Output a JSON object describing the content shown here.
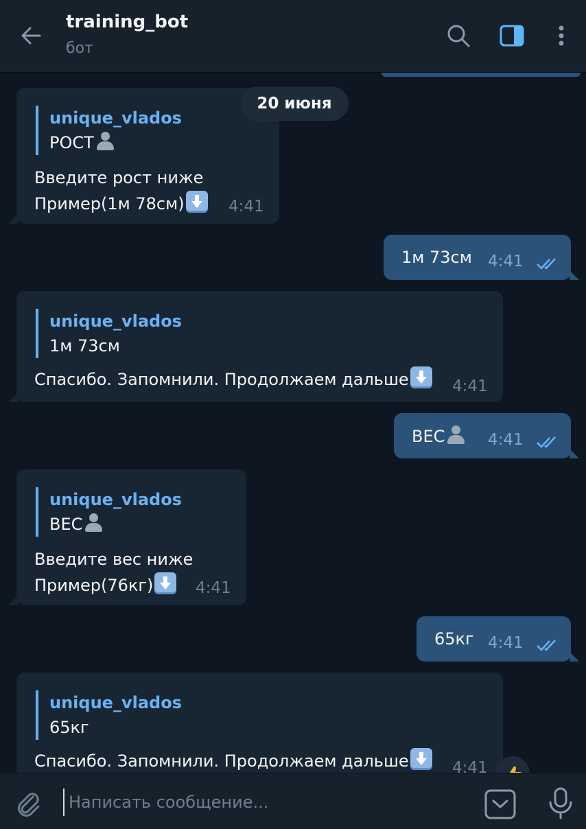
{
  "header": {
    "title": "training_bot",
    "subtitle": "бот",
    "icons": [
      "back-arrow-icon",
      "search-icon",
      "side-panel-icon",
      "more-vertical-icon"
    ]
  },
  "date_separator": "20 июня",
  "messages": [
    {
      "direction": "incoming",
      "quote_author": "unique_vlados",
      "quote_text": "РОСТ",
      "quote_emoji": "person-silhouette",
      "lines": [
        "Введите рост ниже",
        "Пример(1м 78см)"
      ],
      "trailing_emoji": "down-arrow",
      "time": "4:41"
    },
    {
      "direction": "outgoing",
      "text": "1м 73см",
      "time": "4:41",
      "status": "read"
    },
    {
      "direction": "incoming",
      "quote_author": "unique_vlados",
      "quote_text": "1м 73см",
      "lines": [
        "Спасибо. Запомнили. Продолжаем дальше"
      ],
      "trailing_emoji": "down-arrow",
      "time": "4:41"
    },
    {
      "direction": "outgoing",
      "text": "ВЕС",
      "emoji": "person-silhouette",
      "time": "4:41",
      "status": "read"
    },
    {
      "direction": "incoming",
      "quote_author": "unique_vlados",
      "quote_text": "ВЕС",
      "quote_emoji": "person-silhouette",
      "lines": [
        "Введите вес ниже",
        "Пример(76кг)"
      ],
      "trailing_emoji": "down-arrow",
      "time": "4:41"
    },
    {
      "direction": "outgoing",
      "text": "65кг",
      "time": "4:41",
      "status": "read"
    },
    {
      "direction": "incoming",
      "quote_author": "unique_vlados",
      "quote_text": "65кг",
      "lines": [
        "Спасибо. Запомнили. Продолжаем дальше"
      ],
      "trailing_emoji": "down-arrow",
      "time": "4:41"
    }
  ],
  "composer": {
    "placeholder": "Написать сообщение...",
    "icons": [
      "paperclip-icon",
      "bot-commands-icon",
      "microphone-icon"
    ]
  },
  "colors": {
    "background": "#0e1621",
    "header": "#17212b",
    "incoming_bubble": "#182533",
    "outgoing_bubble": "#2b5278",
    "accent": "#6ab2f2",
    "secondary_text": "#708499"
  }
}
